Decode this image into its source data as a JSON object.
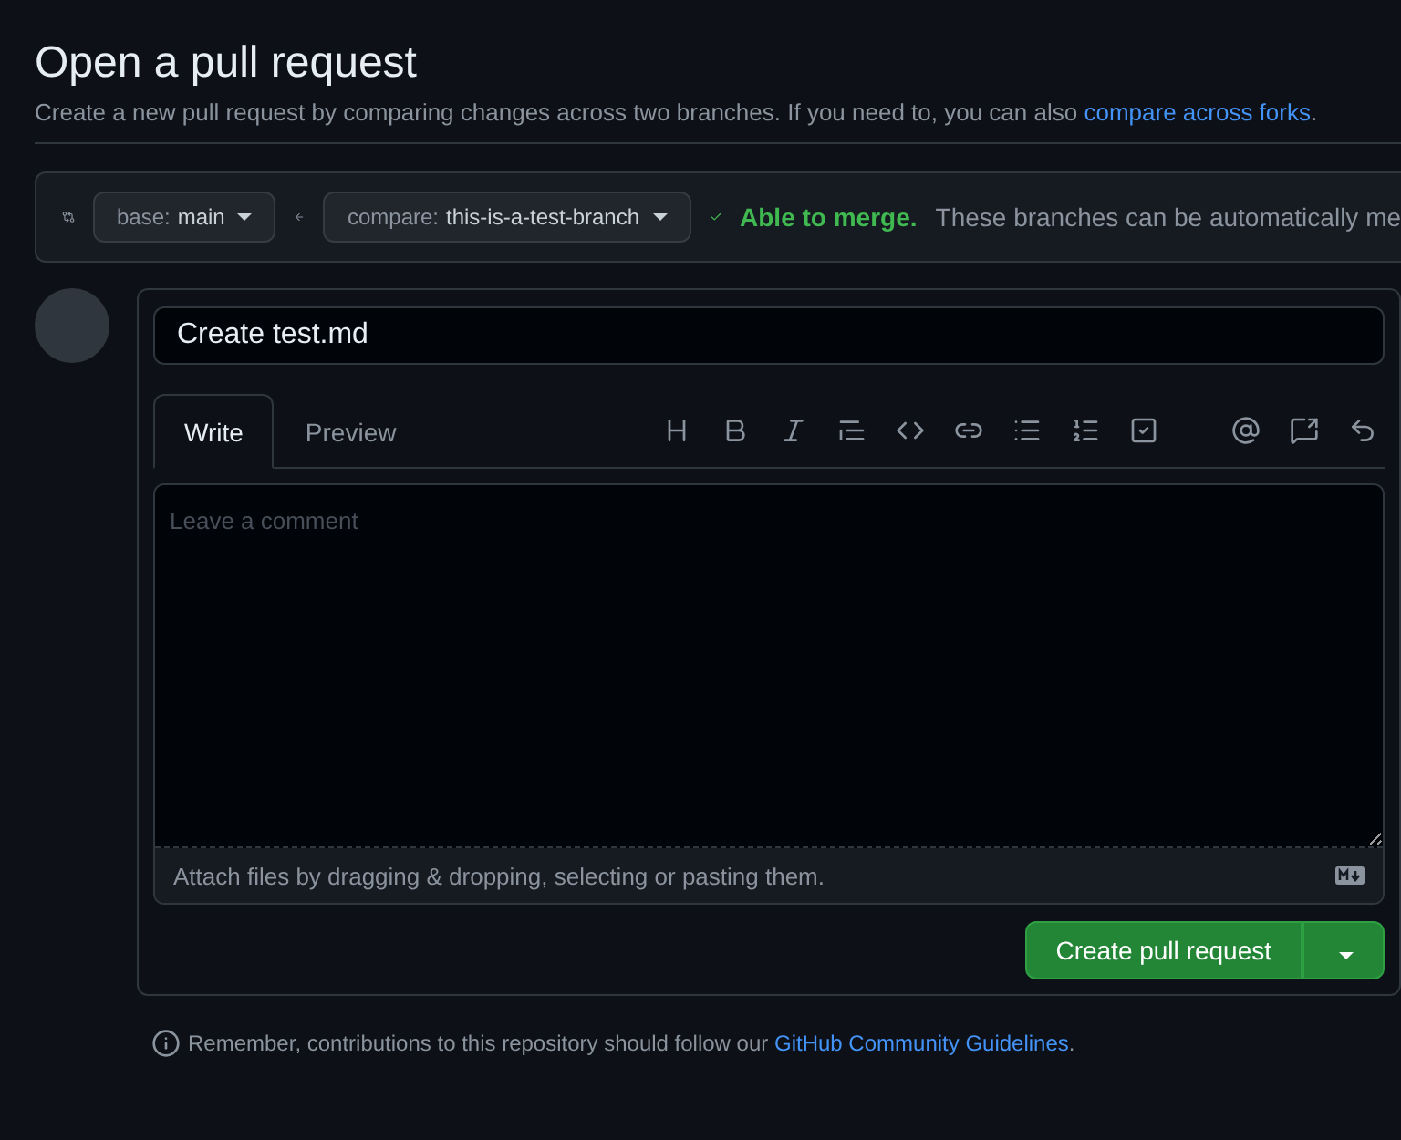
{
  "title": "Open a pull request",
  "subtitle": {
    "text": "Create a new pull request by comparing changes across two branches. If you need to, you can also ",
    "link": "compare across forks",
    "after": "."
  },
  "compare_bar": {
    "base": {
      "prefix": "base:",
      "branch": "main"
    },
    "compare": {
      "prefix": "compare:",
      "branch": "this-is-a-test-branch"
    },
    "status": "Able to merge.",
    "message": "These branches can be automatically me"
  },
  "form": {
    "title_value": "Create test.md",
    "tabs": [
      {
        "label": "Write",
        "selected": true
      },
      {
        "label": "Preview",
        "selected": false
      }
    ],
    "placeholder": "Leave a comment",
    "attach_hint": "Attach files by dragging & dropping, selecting or pasting them.",
    "submit": "Create pull request"
  },
  "footer": {
    "text": "Remember, contributions to this repository should follow our ",
    "link": "GitHub Community Guidelines",
    "after": "."
  }
}
